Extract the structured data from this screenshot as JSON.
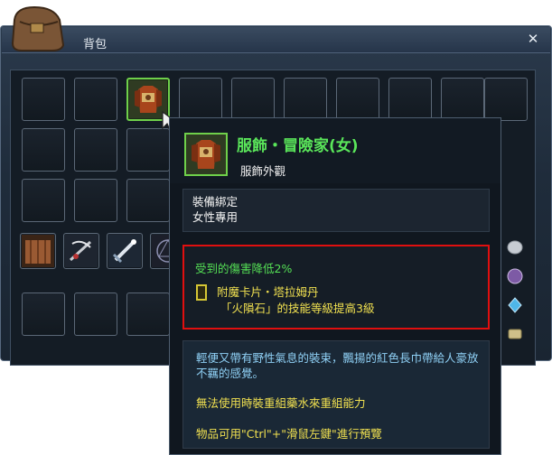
{
  "window": {
    "title": "背包",
    "close_symbol": "✕"
  },
  "tooltip": {
    "item_name": "服飾・冒險家(女)",
    "item_type": "服飾外觀",
    "bind_line": "裝備綁定",
    "gender_line": "女性專用",
    "stat_line": "受到的傷害降低2%",
    "enchant_name": "附魔卡片・塔拉姆丹",
    "enchant_effect": "「火隕石」的技能等級提高3級",
    "description": "輕便又帶有野性氣息的裝束，飄揚的紅色長巾帶給人豪放不羈的感覺。",
    "restriction": "無法使用時裝重組藥水來重組能力",
    "preview_hint": "物品可用\"Ctrl\"+\"滑鼠左鍵\"進行預覽"
  },
  "colors": {
    "item_name": "#5ae65a",
    "stat": "#55e055",
    "enchant": "#f0e050",
    "description": "#8fd0f5",
    "highlight_border": "#e00f0f",
    "selected_slot_border": "#6fd04a"
  },
  "icons": [
    "bag-icon",
    "costume-icon",
    "wood-plank-icon",
    "crossbow-icon",
    "sword-icon",
    "magic-circle-icon",
    "silver-coin-icon",
    "purple-orb-icon",
    "blue-crystal-icon",
    "scroll-icon",
    "cursor-icon",
    "close-icon"
  ]
}
